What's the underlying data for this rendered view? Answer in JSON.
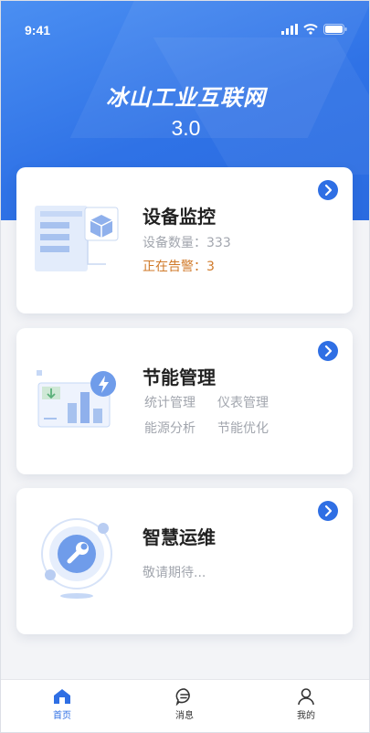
{
  "status_bar": {
    "time": "9:41"
  },
  "header": {
    "title": "冰山工业互联网",
    "version": "3.0"
  },
  "colors": {
    "accent": "#2f6fe4",
    "hero": "#3b7cee",
    "warning": "#d07a2a",
    "muted": "#a2a6ae"
  },
  "cards": [
    {
      "title": "设备监控",
      "device_count": "设备数量：333",
      "alarm_count": "正在告警：3",
      "icon": "chevron-right-icon"
    },
    {
      "title": "节能管理",
      "links": [
        "统计管理",
        "仪表管理",
        "能源分析",
        "节能优化"
      ],
      "icon": "chevron-right-icon"
    },
    {
      "title": "智慧运维",
      "subtitle": "敬请期待...",
      "icon": "chevron-right-icon"
    }
  ],
  "tabbar": {
    "items": [
      {
        "label": "首页",
        "icon": "home-icon",
        "active": true
      },
      {
        "label": "消息",
        "icon": "message-icon",
        "active": false
      },
      {
        "label": "我的",
        "icon": "user-icon",
        "active": false
      }
    ]
  }
}
